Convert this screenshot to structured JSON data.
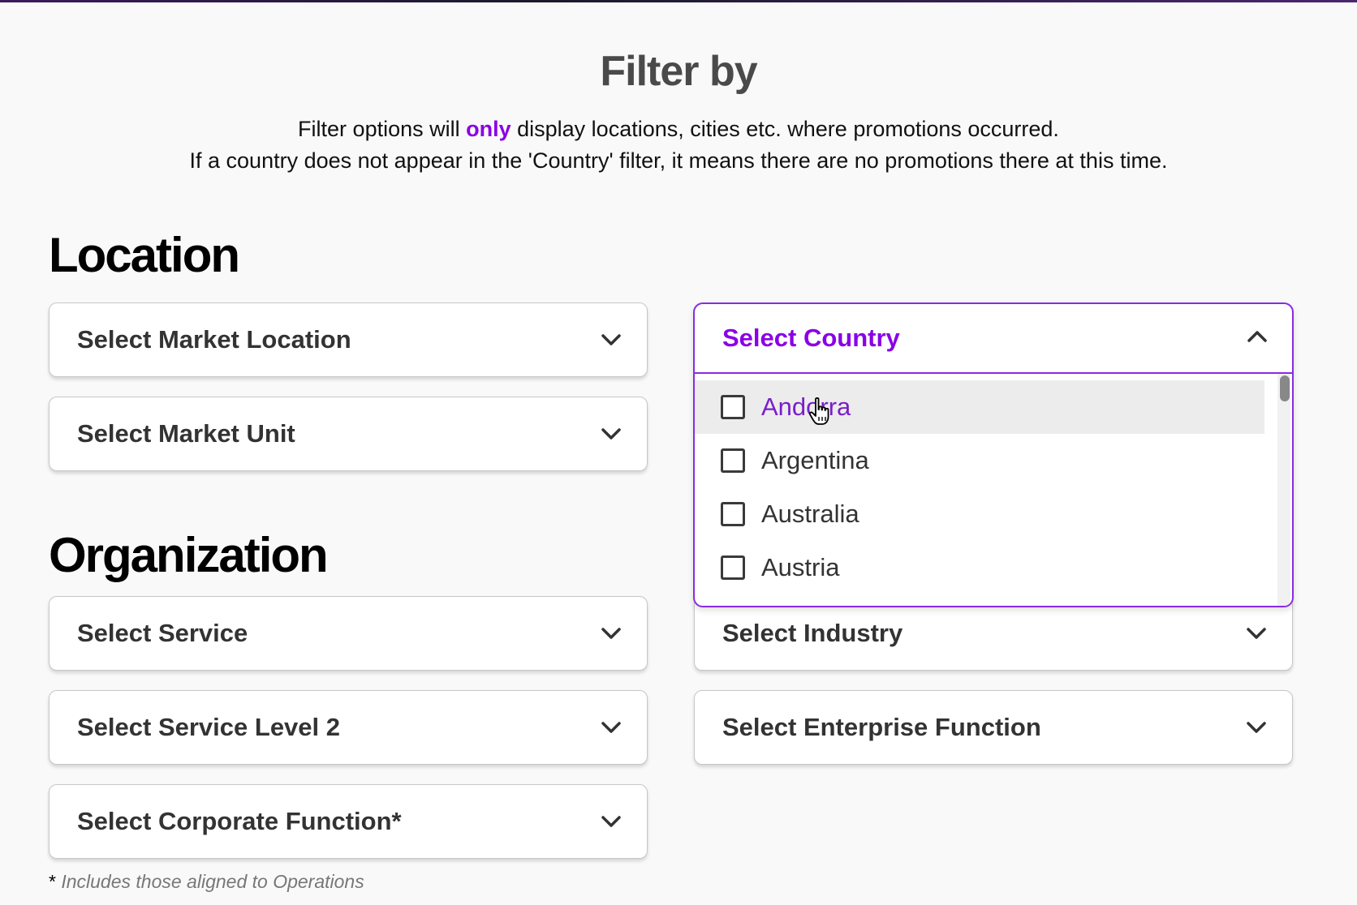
{
  "header": {
    "title": "Filter by",
    "subtitle_pre": "Filter options will ",
    "subtitle_highlight": "only",
    "subtitle_post": " display locations, cities etc. where promotions occurred.",
    "subtitle_line2": "If a country does not appear in the 'Country' filter, it means there are no promotions there at this time."
  },
  "location": {
    "title": "Location",
    "market_location": "Select Market Location",
    "market_unit": "Select Market Unit"
  },
  "country_dropdown": {
    "label": "Select Country",
    "expanded": true,
    "hovered_option": "Andorra",
    "options": [
      {
        "label": "Andorra",
        "checked": false
      },
      {
        "label": "Argentina",
        "checked": false
      },
      {
        "label": "Australia",
        "checked": false
      },
      {
        "label": "Austria",
        "checked": false
      }
    ]
  },
  "organization": {
    "title": "Organization",
    "service": "Select Service",
    "industry": "Select Industry",
    "service_level_2": "Select Service Level 2",
    "enterprise_function": "Select Enterprise Function",
    "corporate_function": "Select Corporate Function*"
  },
  "footnote": {
    "star": "*",
    "text": " Includes those aligned to Operations"
  },
  "colors": {
    "accent": "#8a00e6",
    "border_active": "#8a2be2",
    "background": "#f9f9f9"
  },
  "icons": {
    "collapsed": "chevron-down-icon",
    "expanded": "chevron-up-icon",
    "pointer": "hand-pointer-icon"
  }
}
